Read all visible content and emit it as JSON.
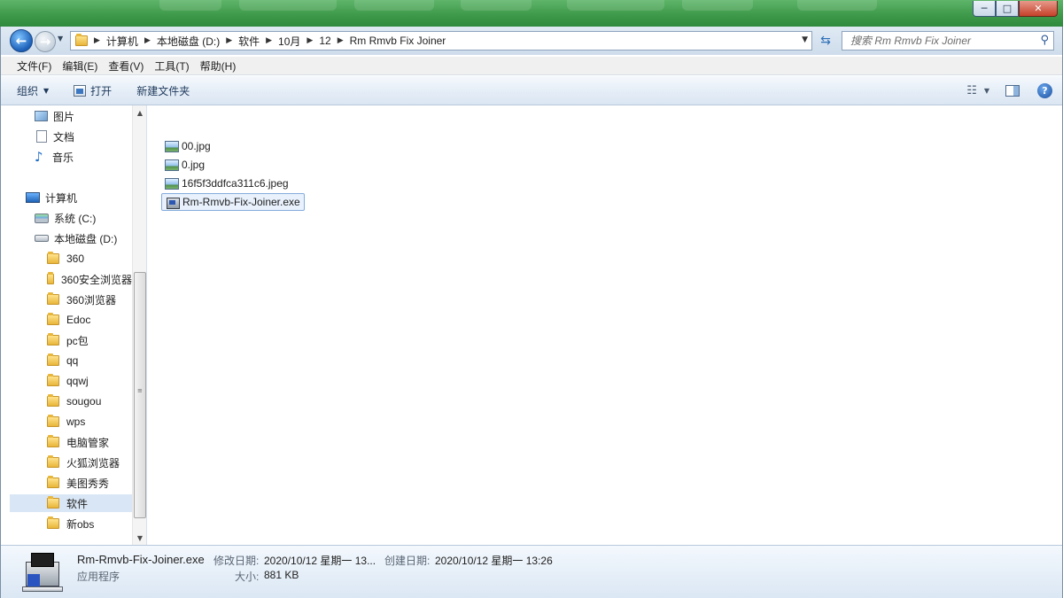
{
  "window": {
    "controls": {
      "minimize": "─",
      "maximize": "□",
      "close": "✕"
    }
  },
  "address": {
    "crumbs": [
      "计算机",
      "本地磁盘 (D:)",
      "软件",
      "10月",
      "12",
      "Rm Rmvb Fix Joiner"
    ]
  },
  "search": {
    "placeholder": "搜索 Rm Rmvb Fix Joiner"
  },
  "menubar": {
    "items": [
      "文件(F)",
      "编辑(E)",
      "查看(V)",
      "工具(T)",
      "帮助(H)"
    ]
  },
  "toolbar": {
    "organize": "组织",
    "open": "打开",
    "new_folder": "新建文件夹"
  },
  "navpane": {
    "libraries": [
      "图片",
      "文档",
      "音乐"
    ],
    "computer": "计算机",
    "drives": [
      "系统 (C:)",
      "本地磁盘 (D:)"
    ],
    "folders": [
      "360",
      "360安全浏览器",
      "360浏览器",
      "Edoc",
      "pc包",
      "qq",
      "qqwj",
      "sougou",
      "wps",
      "电脑管家",
      "火狐浏览器",
      "美图秀秀",
      "软件",
      "新obs"
    ],
    "selected_folder": "软件"
  },
  "files": [
    {
      "name": "00.jpg",
      "icon": "image-file-icon",
      "selected": false
    },
    {
      "name": "0.jpg",
      "icon": "image-file-icon",
      "selected": false
    },
    {
      "name": "16f5f3ddfca311c6.jpeg",
      "icon": "image-file-icon",
      "selected": false
    },
    {
      "name": "Rm-Rmvb-Fix-Joiner.exe",
      "icon": "exe-installer-icon",
      "selected": true
    }
  ],
  "details": {
    "filename": "Rm-Rmvb-Fix-Joiner.exe",
    "type": "应用程序",
    "modified_label": "修改日期:",
    "modified_value": "2020/10/12 星期一 13...",
    "created_label": "创建日期:",
    "created_value": "2020/10/12 星期一 13:26",
    "size_label": "大小:",
    "size_value": "881 KB"
  },
  "colors": {
    "selection_bg": "#d9e6f5",
    "file_selection_border": "#84acdd",
    "toolbar_text": "#1e395b",
    "title_green": "#3f9a4b"
  }
}
